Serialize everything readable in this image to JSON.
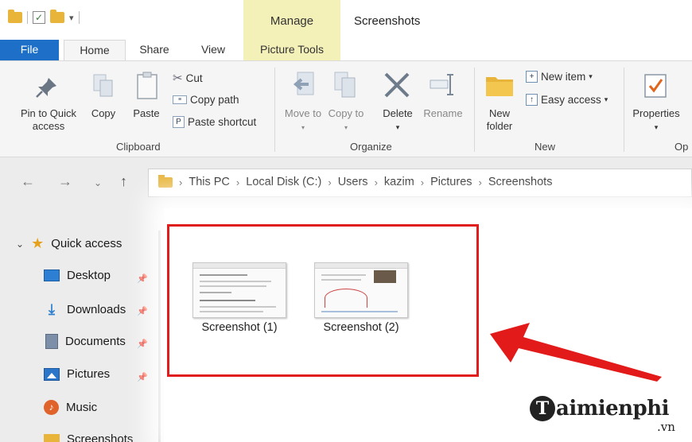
{
  "window": {
    "title": "Screenshots",
    "contextual_group": "Manage"
  },
  "tabs": {
    "file": "File",
    "home": "Home",
    "share": "Share",
    "view": "View",
    "picture_tools": "Picture Tools"
  },
  "ribbon": {
    "clipboard": {
      "pin": "Pin to Quick access",
      "copy": "Copy",
      "paste": "Paste",
      "cut": "Cut",
      "copy_path": "Copy path",
      "paste_shortcut": "Paste shortcut",
      "label": "Clipboard"
    },
    "organize": {
      "move_to": "Move to",
      "copy_to": "Copy to",
      "delete": "Delete",
      "rename": "Rename",
      "label": "Organize"
    },
    "new": {
      "new_folder": "New folder",
      "new_item": "New item",
      "easy_access": "Easy access",
      "label": "New"
    },
    "open": {
      "properties": "Properties",
      "label": "Op"
    }
  },
  "address": {
    "crumbs": [
      "This PC",
      "Local Disk (C:)",
      "Users",
      "kazim",
      "Pictures",
      "Screenshots"
    ]
  },
  "sidebar": {
    "quick_access": "Quick access",
    "items": [
      {
        "label": "Desktop",
        "icon": "desktop-icon",
        "pinned": true
      },
      {
        "label": "Downloads",
        "icon": "download-icon",
        "pinned": true
      },
      {
        "label": "Documents",
        "icon": "document-icon",
        "pinned": true
      },
      {
        "label": "Pictures",
        "icon": "pictures-icon",
        "pinned": true
      },
      {
        "label": "Music",
        "icon": "music-icon",
        "pinned": false
      },
      {
        "label": "Screenshots",
        "icon": "folder-icon",
        "pinned": false
      }
    ]
  },
  "files": [
    {
      "name": "Screenshot (1)"
    },
    {
      "name": "Screenshot (2)"
    }
  ],
  "watermark": {
    "brand": "aimienphi",
    "brand_initial": "T",
    "domain": ".vn"
  },
  "colors": {
    "file_tab": "#1d6fc7",
    "manage_tab": "#f3f0b8",
    "highlight": "#e01d1d"
  }
}
